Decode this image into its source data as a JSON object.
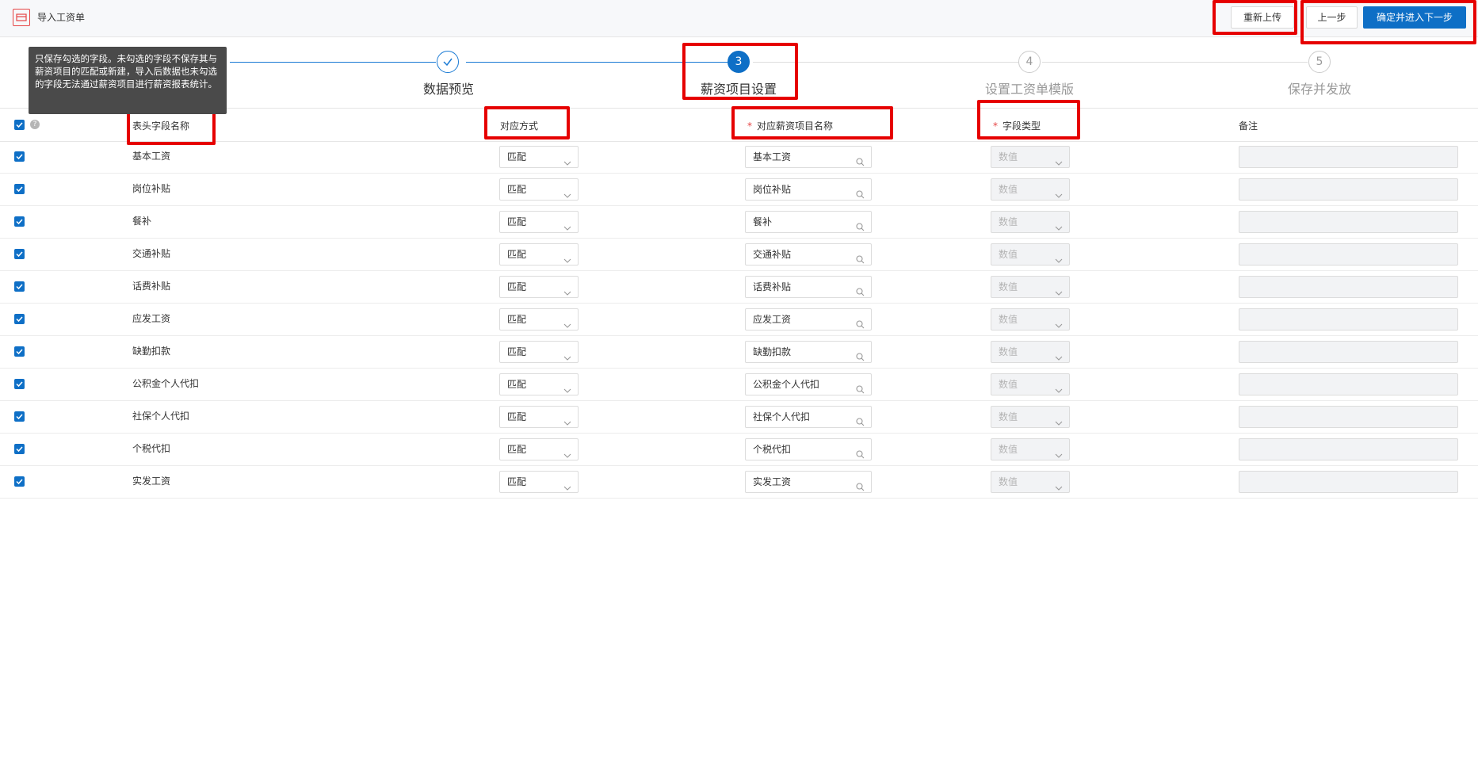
{
  "header": {
    "title": "导入工资单",
    "reupload_label": "重新上传",
    "prev_label": "上一步",
    "next_label": "确定并进入下一步"
  },
  "steps": [
    {
      "index": "✓",
      "label": "数据预览",
      "status": "done"
    },
    {
      "index": "3",
      "label": "薪资项目设置",
      "status": "active"
    },
    {
      "index": "4",
      "label": "设置工资单模版",
      "status": "todo"
    },
    {
      "index": "5",
      "label": "保存并发放",
      "status": "todo"
    }
  ],
  "tooltip": {
    "text": "只保存勾选的字段。未勾选的字段不保存其与薪资项目的匹配或新建，导入后数据也未勾选的字段无法通过薪资项目进行薪资报表统计。"
  },
  "table": {
    "columns": {
      "field_name": "表头字段名称",
      "mapping": "对应方式",
      "salary_item": "对应薪资项目名称",
      "field_type": "字段类型",
      "remark": "备注"
    },
    "rows": [
      {
        "name": "基本工资",
        "mapping": "匹配",
        "item": "基本工资",
        "type": "数值",
        "checked": true
      },
      {
        "name": "岗位补贴",
        "mapping": "匹配",
        "item": "岗位补贴",
        "type": "数值",
        "checked": true
      },
      {
        "name": "餐补",
        "mapping": "匹配",
        "item": "餐补",
        "type": "数值",
        "checked": true
      },
      {
        "name": "交通补贴",
        "mapping": "匹配",
        "item": "交通补贴",
        "type": "数值",
        "checked": true
      },
      {
        "name": "话费补贴",
        "mapping": "匹配",
        "item": "话费补贴",
        "type": "数值",
        "checked": true
      },
      {
        "name": "应发工资",
        "mapping": "匹配",
        "item": "应发工资",
        "type": "数值",
        "checked": true
      },
      {
        "name": "缺勤扣款",
        "mapping": "匹配",
        "item": "缺勤扣款",
        "type": "数值",
        "checked": true
      },
      {
        "name": "公积金个人代扣",
        "mapping": "匹配",
        "item": "公积金个人代扣",
        "type": "数值",
        "checked": true
      },
      {
        "name": "社保个人代扣",
        "mapping": "匹配",
        "item": "社保个人代扣",
        "type": "数值",
        "checked": true
      },
      {
        "name": "个税代扣",
        "mapping": "匹配",
        "item": "个税代扣",
        "type": "数值",
        "checked": true
      },
      {
        "name": "实发工资",
        "mapping": "匹配",
        "item": "实发工资",
        "type": "数值",
        "checked": true
      }
    ]
  },
  "colors": {
    "primary": "#0e6fc6",
    "highlight": "#e60000",
    "required": "#e64545"
  }
}
